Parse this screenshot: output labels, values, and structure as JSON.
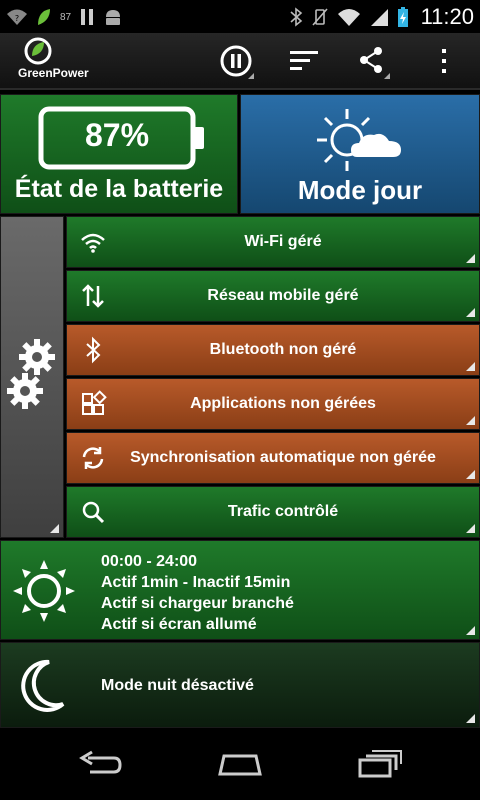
{
  "status_bar": {
    "battery_small_text": "87",
    "time": "11:20"
  },
  "app": {
    "name": "GreenPower"
  },
  "battery_tile": {
    "percent": "87%",
    "label": "État de la batterie"
  },
  "mode_tile": {
    "label": "Mode jour"
  },
  "rows": [
    {
      "label": "Wi-Fi géré",
      "icon": "wifi-icon",
      "color": "#1f7a2a"
    },
    {
      "label": "Réseau mobile géré",
      "icon": "mobile-data-icon",
      "color": "#1f7a2a"
    },
    {
      "label": "Bluetooth non géré",
      "icon": "bluetooth-icon",
      "color": "#b85a2a"
    },
    {
      "label": "Applications non gérées",
      "icon": "apps-icon",
      "color": "#b85a2a"
    },
    {
      "label": "Synchronisation automatique non gérée",
      "icon": "sync-icon",
      "color": "#b85a2a"
    },
    {
      "label": "Trafic contrôlé",
      "icon": "search-icon",
      "color": "#1f7a2a"
    }
  ],
  "schedule": {
    "line1": "00:00 - 24:00",
    "line2": "Actif 1min - Inactif 15min",
    "line3": "Actif si chargeur branché",
    "line4": "Actif si écran allumé"
  },
  "night_mode": {
    "label": "Mode nuit désactivé"
  }
}
